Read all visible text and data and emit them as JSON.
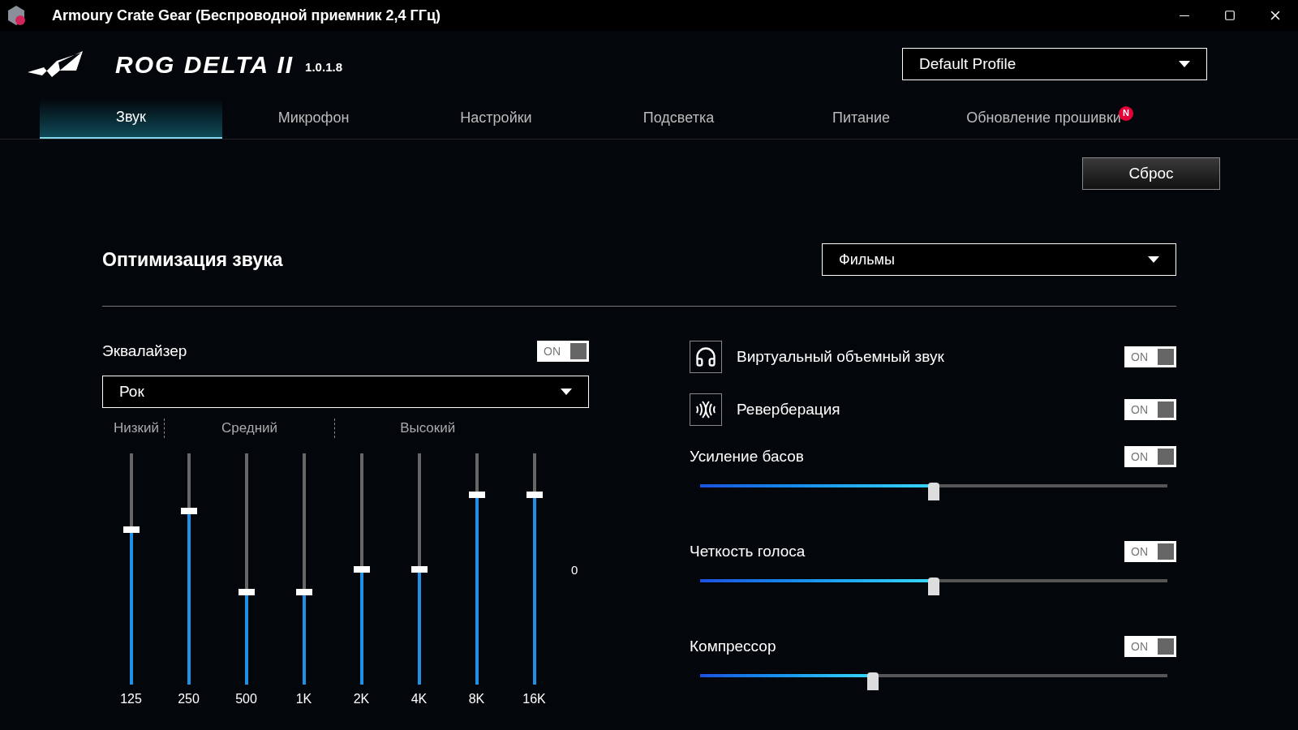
{
  "window": {
    "title": "Armoury Crate Gear (Беспроводной приемник 2,4 ГГц)"
  },
  "header": {
    "product": "ROG DELTA II",
    "version": "1.0.1.8",
    "profile": "Default Profile"
  },
  "tabs": [
    {
      "label": "Звук",
      "selected": true
    },
    {
      "label": "Микрофон",
      "selected": false
    },
    {
      "label": "Настройки",
      "selected": false
    },
    {
      "label": "Подсветка",
      "selected": false
    },
    {
      "label": "Питание",
      "selected": false
    },
    {
      "label": "Обновление прошивки",
      "selected": false,
      "badge": "N"
    }
  ],
  "reset_button": "Сброс",
  "section": {
    "title": "Оптимизация звука",
    "preset": "Фильмы"
  },
  "equalizer": {
    "label": "Эквалайзер",
    "on": true,
    "toggle_text": "ON",
    "preset": "Рок",
    "ranges": [
      "Низкий",
      "Средний",
      "Высокий"
    ],
    "zero_label": "0",
    "bands": [
      {
        "label": "125",
        "level": 0.67
      },
      {
        "label": "250",
        "level": 0.75
      },
      {
        "label": "500",
        "level": 0.4
      },
      {
        "label": "1K",
        "level": 0.4
      },
      {
        "label": "2K",
        "level": 0.5
      },
      {
        "label": "4K",
        "level": 0.5
      },
      {
        "label": "8K",
        "level": 0.82
      },
      {
        "label": "16K",
        "level": 0.82
      }
    ]
  },
  "effects": [
    {
      "kind": "icon",
      "label": "Виртуальный объемный звук",
      "on": true,
      "toggle_text": "ON"
    },
    {
      "kind": "icon",
      "label": "Реверберация",
      "on": true,
      "toggle_text": "ON"
    },
    {
      "kind": "slider",
      "label": "Усиление басов",
      "on": true,
      "toggle_text": "ON",
      "level": 0.5
    },
    {
      "kind": "slider",
      "label": "Четкость голоса",
      "on": true,
      "toggle_text": "ON",
      "level": 0.5
    },
    {
      "kind": "slider",
      "label": "Компрессор",
      "on": true,
      "toggle_text": "ON",
      "level": 0.37
    }
  ]
}
